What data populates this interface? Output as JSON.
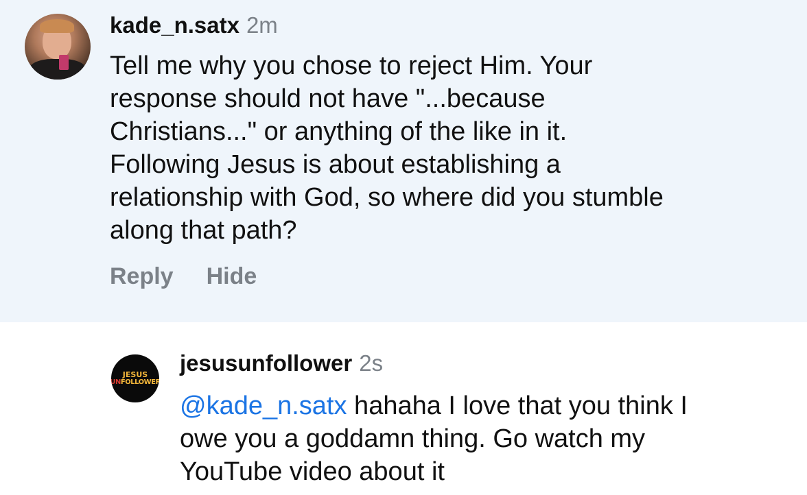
{
  "comment": {
    "username": "kade_n.satx",
    "time": "2m",
    "text_lines": [
      "Tell me why you chose to reject Him. Your",
      "response should not have \"...because",
      "Christians...\" or anything of the like in it.",
      "Following Jesus is about establishing a",
      "relationship with God, so where did you stumble",
      "along that path?"
    ],
    "actions": {
      "reply_label": "Reply",
      "hide_label": "Hide"
    }
  },
  "reply": {
    "username": "jesusunfollower",
    "time": "2s",
    "mention": "@kade_n.satx",
    "text_lines": [
      " hahaha I love that you think I",
      "owe you a goddamn thing. Go watch my",
      "YouTube video about it"
    ],
    "avatar_logo": {
      "line1": "JESUS",
      "line2_prefix": "UN",
      "line2_rest": "FOLLOWER"
    }
  },
  "colors": {
    "highlight_bg": "#eff5fb",
    "mention": "#1b74e4",
    "muted": "#7b8188"
  }
}
